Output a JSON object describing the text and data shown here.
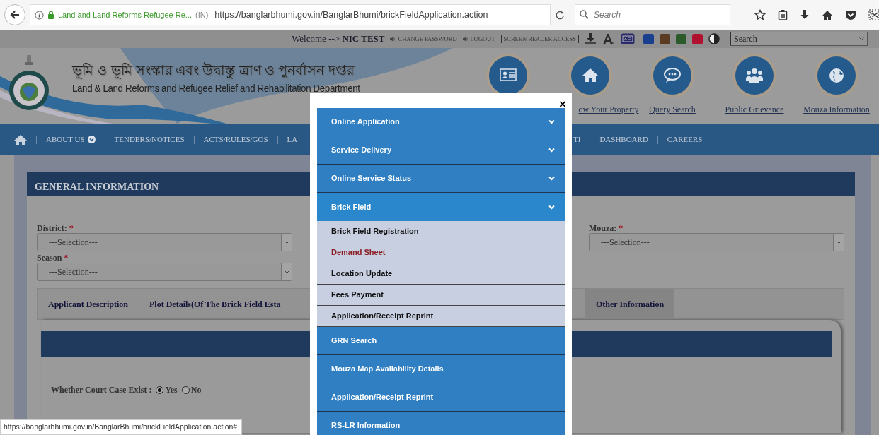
{
  "browser": {
    "site_title": "Land and Land Reforms Refugee Re...",
    "site_country": "(IN)",
    "url": "https://banglarbhumi.gov.in/BanglarBhumi/brickFieldApplication.action",
    "search": {
      "placeholder": "Search"
    }
  },
  "top_bar": {
    "welcome": "Welcome --> **NIC TEST**",
    "links": [
      "CHANGE PASSWORD",
      "LOGOUT"
    ],
    "screen_reader": "SCREEN READER ACCESS",
    "theme_colors": [
      {
        "color": "#1a3f8f"
      },
      {
        "color": "#5b3b22"
      },
      {
        "color": "#2b5b28"
      },
      {
        "color": "#b0112e"
      }
    ],
    "search_select": "Search"
  },
  "header": {
    "title_bn": "ভূমি ও ভূমি সংস্কার এবং উদ্বাস্তু ত্রাণ ও পুনর্বাসন দপ্তর",
    "title_en": "Land & Land Reforms and Refugee Relief and Rehabilitation Department",
    "quick_links": [
      {
        "kind": "card"
      },
      {
        "kind": "home",
        "label": "ow Your Property"
      },
      {
        "kind": "chat",
        "label": "Query Search"
      },
      {
        "kind": "people",
        "label": "Public Grievance"
      },
      {
        "kind": "globe",
        "label": "Mouza Information"
      }
    ]
  },
  "nav": {
    "left": [
      {
        "kind": "dropdown",
        "label": "ABOUT US"
      },
      {
        "kind": "link",
        "label": "TENDERS/NOTICES"
      },
      {
        "kind": "link",
        "label": "ACTS/RULES/GOS"
      },
      {
        "kind": "link",
        "label": "LA"
      }
    ],
    "right": [
      {
        "kind": "link",
        "label": "TI"
      },
      {
        "kind": "link",
        "label": "DASHBOARD"
      },
      {
        "kind": "link",
        "label": "CAREERS"
      }
    ]
  },
  "general_information": {
    "title": "GENERAL INFORMATION",
    "fields": [
      {
        "label": "District:",
        "required_mark": "*",
        "value": "---Selection---"
      },
      {
        "label": "Mouza:",
        "required_mark": "*",
        "value": "---Selection---"
      },
      {
        "label": "Season",
        "required_mark": "*",
        "value": "---Selection---"
      }
    ],
    "tabs": [
      {
        "label": "Applicant Description",
        "selected": false
      },
      {
        "label": "Plot Details(Of The Brick Field Esta",
        "selected": false
      },
      {
        "label": "Other Information",
        "selected": true
      }
    ],
    "court_case": {
      "question": "Whether Court Case Exist :",
      "options": [
        {
          "label": "Yes",
          "selected": true
        },
        {
          "label": "No",
          "selected": false
        }
      ]
    }
  },
  "status_link": "https://banglarbhumi.gov.in/BanglarBhumi/brickFieldApplication.action#",
  "modal": {
    "close": "×",
    "menu": [
      {
        "kind": "group",
        "label": "Online Application",
        "expanded": false
      },
      {
        "kind": "group",
        "label": "Service Delivery",
        "expanded": false
      },
      {
        "kind": "group",
        "label": "Online Service Status",
        "expanded": false
      },
      {
        "kind": "group",
        "label": "Brick Field",
        "expanded": true,
        "children": [
          {
            "label": "Brick Field Registration",
            "selected": false
          },
          {
            "label": "Demand Sheet",
            "selected": true
          },
          {
            "label": "Location Update",
            "selected": false
          },
          {
            "label": "Fees Payment",
            "selected": false
          },
          {
            "label": "Application/Receipt Reprint",
            "selected": false
          }
        ]
      },
      {
        "kind": "link",
        "label": "GRN Search"
      },
      {
        "kind": "link",
        "label": "Mouza Map Availability Details"
      },
      {
        "kind": "link",
        "label": "Application/Receipt Reprint"
      },
      {
        "kind": "link",
        "label": "RS-LR Information"
      }
    ]
  }
}
